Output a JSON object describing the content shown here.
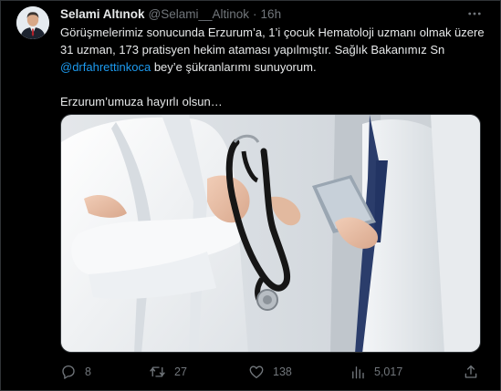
{
  "tweet": {
    "author": {
      "display_name": "Selami Altınok",
      "handle": "@Selami__Altinok",
      "separator": "·",
      "time": "16h"
    },
    "text": {
      "line1": "Görüşmelerimiz sonucunda Erzurum’a, 1’i çocuk Hematoloji uzmanı olmak üzere 31 uzman, 173 pratisyen hekim ataması yapılmıştır. Sağlık Bakanımız Sn ",
      "mention": "@drfahrettinkoca",
      "line1_end": " bey’e şükranlarımı sunuyorum.",
      "line2": "Erzurum’umuza hayırlı olsun…"
    },
    "media": {
      "icon": "photo-doctors-with-stethoscope"
    },
    "actions": {
      "replies": "8",
      "retweets": "27",
      "likes": "138",
      "views": "5,017"
    },
    "icons": {
      "more": "more-icon",
      "reply": "reply-icon",
      "retweet": "retweet-icon",
      "like": "heart-icon",
      "views": "views-icon",
      "share": "share-icon"
    },
    "colors": {
      "background": "#000000",
      "text": "#e7e9ea",
      "muted": "#71767b",
      "link": "#1d9bf0"
    }
  }
}
